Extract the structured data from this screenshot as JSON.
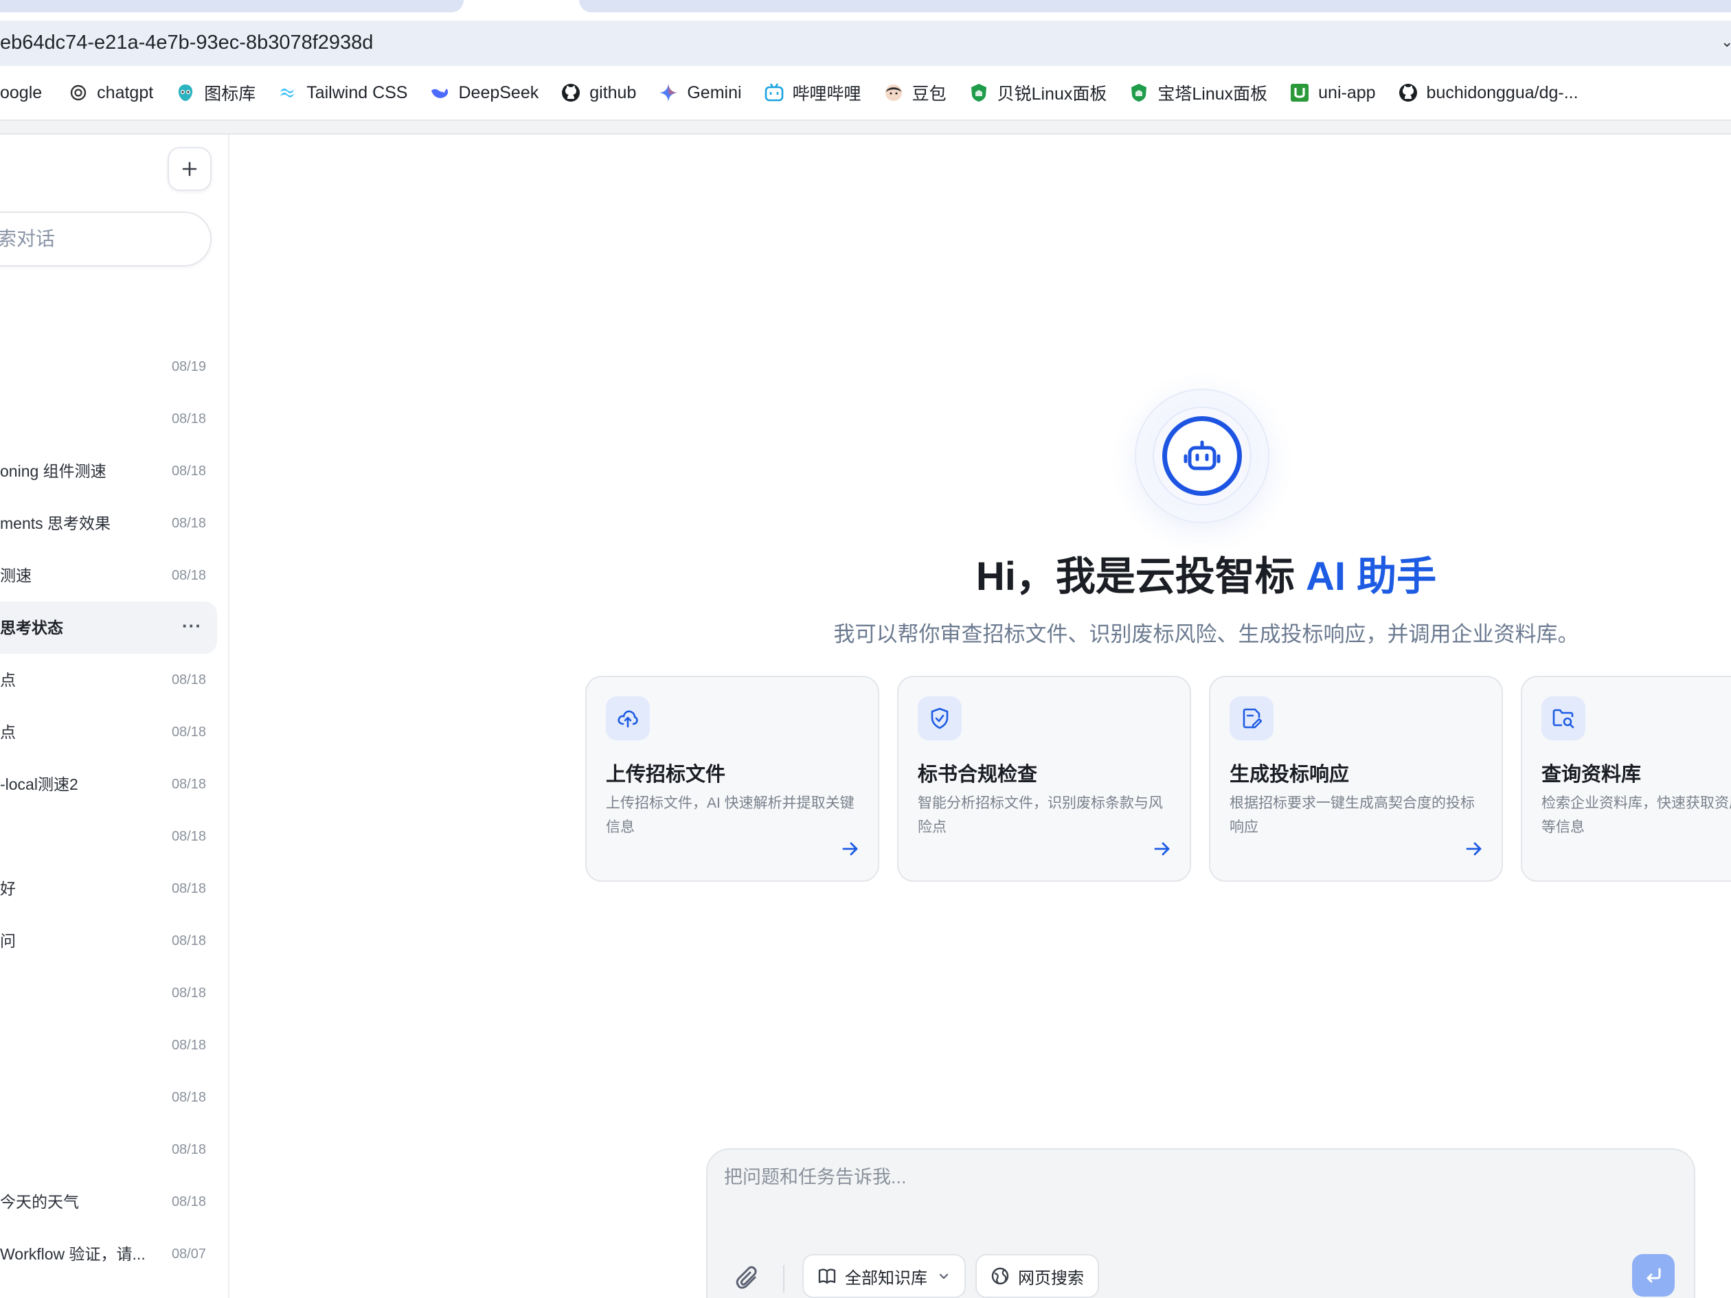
{
  "browser": {
    "url": "eb64dc74-e21a-4e7b-93ec-8b3078f2938d",
    "bookmarks": [
      {
        "label": "oogle",
        "icon": "google-icon"
      },
      {
        "label": "chatgpt",
        "icon": "chatgpt-icon"
      },
      {
        "label": "图标库",
        "icon": "iconfont-icon"
      },
      {
        "label": "Tailwind CSS",
        "icon": "tailwind-icon"
      },
      {
        "label": "DeepSeek",
        "icon": "deepseek-icon"
      },
      {
        "label": "github",
        "icon": "github-icon"
      },
      {
        "label": "Gemini",
        "icon": "gemini-icon"
      },
      {
        "label": "哔哩哔哩",
        "icon": "bilibili-icon"
      },
      {
        "label": "豆包",
        "icon": "doubao-icon"
      },
      {
        "label": "贝锐Linux面板",
        "icon": "shield-green-icon"
      },
      {
        "label": "宝塔Linux面板",
        "icon": "shield-green-icon"
      },
      {
        "label": "uni-app",
        "icon": "uniapp-icon"
      },
      {
        "label": "buchidonggua/dg-...",
        "icon": "github-icon"
      }
    ]
  },
  "sidebar": {
    "search_placeholder": "索对话",
    "conversations": [
      {
        "title": "",
        "date": "08/19"
      },
      {
        "title": "",
        "date": "08/18"
      },
      {
        "title": "oning 组件测速",
        "date": "08/18"
      },
      {
        "title": "ments 思考效果",
        "date": "08/18"
      },
      {
        "title": "测速",
        "date": "08/18"
      },
      {
        "title": "思考状态",
        "date": "",
        "active": true
      },
      {
        "title": "点",
        "date": "08/18"
      },
      {
        "title": "点",
        "date": "08/18"
      },
      {
        "title": "-local测速2",
        "date": "08/18"
      },
      {
        "title": "",
        "date": "08/18"
      },
      {
        "title": "好",
        "date": "08/18"
      },
      {
        "title": "问",
        "date": "08/18"
      },
      {
        "title": "",
        "date": "08/18"
      },
      {
        "title": "",
        "date": "08/18"
      },
      {
        "title": "",
        "date": "08/18"
      },
      {
        "title": "",
        "date": "08/18"
      },
      {
        "title": "今天的天气",
        "date": "08/18"
      },
      {
        "title": "Workflow 验证，请...",
        "date": "08/07"
      }
    ]
  },
  "hero": {
    "title_main": "Hi，我是云投智标 ",
    "title_accent": "AI 助手",
    "subtitle": "我可以帮你审查招标文件、识别废标风险、生成投标响应，并调用企业资料库。"
  },
  "cards": [
    {
      "title": "上传招标文件",
      "desc": "上传招标文件，AI 快速解析并提取关键信息",
      "icon": "cloud-upload-icon"
    },
    {
      "title": "标书合规检查",
      "desc": "智能分析招标文件，识别废标条款与风险点",
      "icon": "shield-check-icon"
    },
    {
      "title": "生成投标响应",
      "desc": "根据招标要求一键生成高契合度的投标响应",
      "icon": "file-edit-icon"
    },
    {
      "title": "查询资料库",
      "desc": "检索企业资料库，快速获取资质、案例等信息",
      "icon": "folder-search-icon"
    }
  ],
  "composer": {
    "placeholder": "把问题和任务告诉我...",
    "knowledge_label": "全部知识库",
    "web_search_label": "网页搜索"
  },
  "colors": {
    "accent": "#1d5be3",
    "send_disabled": "#8fb0f5",
    "card_icon_bg": "#e3eafc"
  }
}
